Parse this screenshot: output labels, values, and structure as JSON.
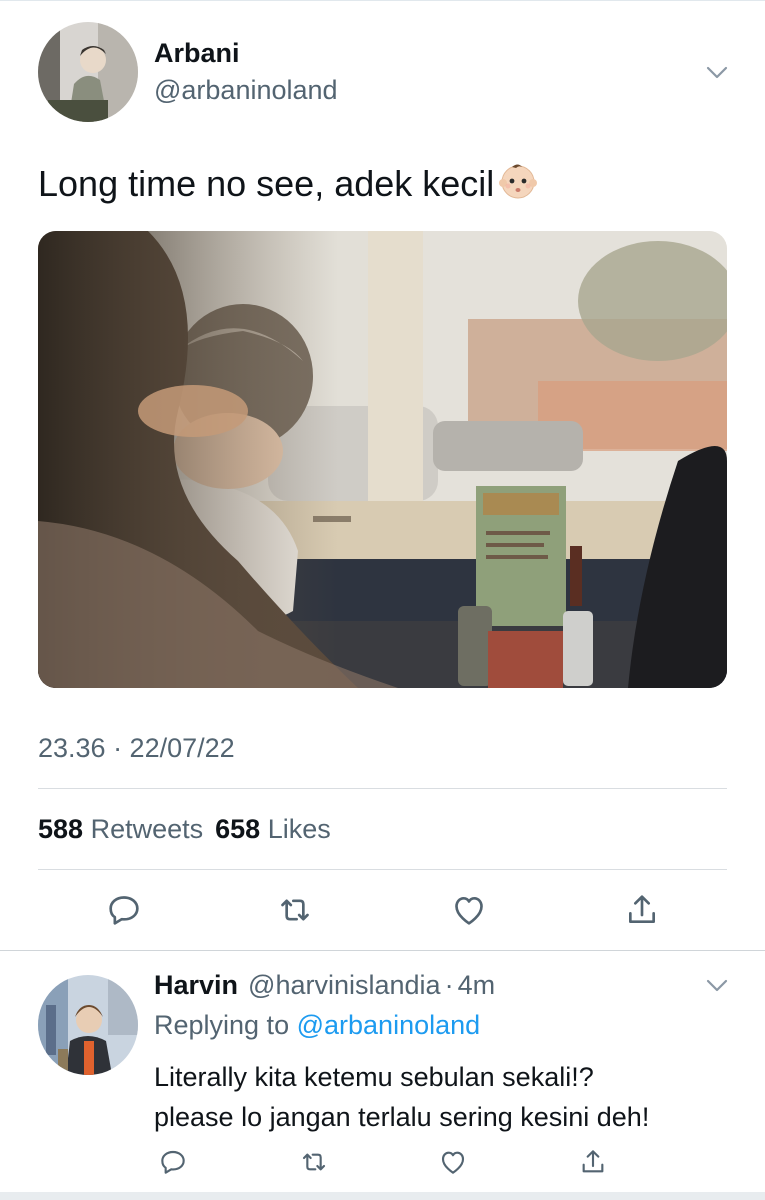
{
  "tweet": {
    "author_name": "Arbani",
    "author_handle": "@arbaninoland",
    "text": "Long time no see, adek kecil",
    "emoji": "baby-emoji",
    "timestamp": "23.36 · 22/07/22",
    "retweets_count": "588",
    "retweets_label": "Retweets",
    "likes_count": "658",
    "likes_label": "Likes",
    "actions": [
      "reply-icon",
      "retweet-icon",
      "like-icon",
      "share-icon"
    ]
  },
  "reply": {
    "author_name": "Harvin",
    "author_handle": "@harvinislandia",
    "separator": "·",
    "time": "4m",
    "replying_prefix": "Replying to",
    "replying_to": "@arbaninoland",
    "text_line1": "Literally kita ketemu sebulan sekali!?",
    "text_line2": "please lo jangan terlalu sering kesini deh!",
    "actions": [
      "reply-icon",
      "retweet-icon",
      "like-icon",
      "share-icon"
    ]
  },
  "colors": {
    "primary_text": "#0f1419",
    "secondary_text": "#536471",
    "link": "#1d9bf0",
    "divider": "#d9dde1"
  }
}
